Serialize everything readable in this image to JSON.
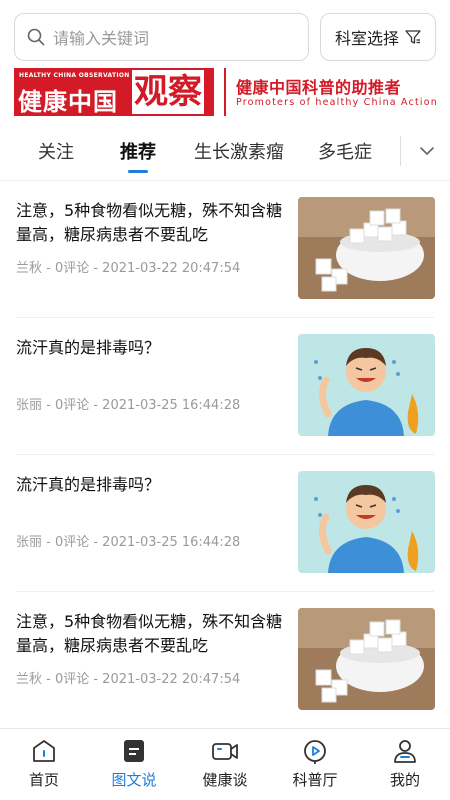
{
  "search": {
    "placeholder": "请输入关键词",
    "dept_label": "科室选择"
  },
  "banner": {
    "small_en": "HEALTHY CHINA OBSERVATION",
    "logo_text": "健康中国",
    "logo_big": "观察",
    "slogan_cn": "健康中国科普的助推者",
    "slogan_en": "Promoters of healthy China Action"
  },
  "tabs": [
    {
      "label": "关注",
      "active": false
    },
    {
      "label": "推荐",
      "active": true
    },
    {
      "label": "生长激素瘤",
      "active": false
    },
    {
      "label": "多毛症",
      "active": false
    }
  ],
  "articles": [
    {
      "title": "注意，5种食物看似无糖，殊不知含糖量高，糖尿病患者不要乱吃",
      "author": "兰秋",
      "comments": "0评论",
      "time": "2021-03-22 20:47:54",
      "meta": "兰秋 - 0评论 - 2021-03-22 20:47:54",
      "image": "sugar-cubes"
    },
    {
      "title": "流汗真的是排毒吗？",
      "author": "张丽",
      "comments": "0评论",
      "time": "2021-03-25 16:44:28",
      "meta": "张丽 - 0评论 - 2021-03-25 16:44:28",
      "image": "sweating-boy"
    },
    {
      "title": "流汗真的是排毒吗？",
      "author": "张丽",
      "comments": "0评论",
      "time": "2021-03-25 16:44:28",
      "meta": "张丽 - 0评论 - 2021-03-25 16:44:28",
      "image": "sweating-boy"
    },
    {
      "title": "注意，5种食物看似无糖，殊不知含糖量高，糖尿病患者不要乱吃",
      "author": "兰秋",
      "comments": "0评论",
      "time": "2021-03-22 20:47:54",
      "meta": "兰秋 - 0评论 - 2021-03-22 20:47:54",
      "image": "sugar-cubes"
    }
  ],
  "nav": [
    {
      "label": "首页",
      "icon": "home-icon",
      "active": false
    },
    {
      "label": "图文说",
      "icon": "article-icon",
      "active": true
    },
    {
      "label": "健康谈",
      "icon": "video-camera-icon",
      "active": false
    },
    {
      "label": "科普厅",
      "icon": "play-icon",
      "active": false
    },
    {
      "label": "我的",
      "icon": "user-icon",
      "active": false
    }
  ],
  "colors": {
    "accent": "#1e7fd8",
    "brand_red": "#d31a26",
    "meta_gray": "#9a9a9a"
  }
}
